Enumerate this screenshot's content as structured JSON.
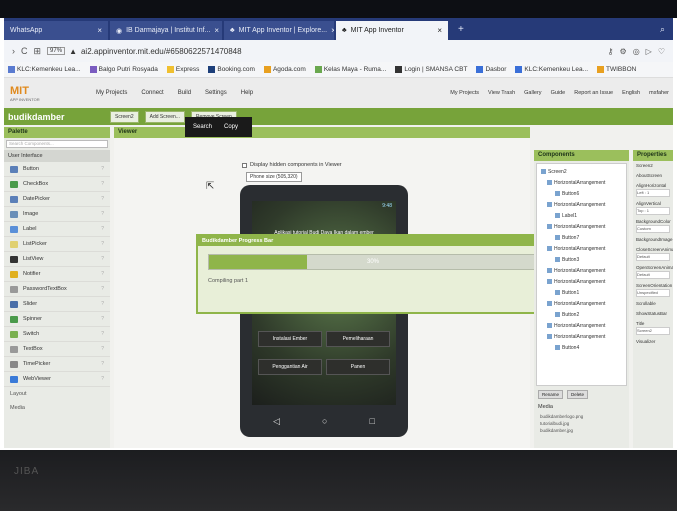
{
  "browser": {
    "tabs": [
      {
        "label": "WhatsApp",
        "active": false
      },
      {
        "label": "IB Darmajaya | Institut Inf...",
        "active": false
      },
      {
        "label": "MIT App Inventor | Explore...",
        "active": false
      },
      {
        "label": "MIT App Inventor",
        "active": true
      }
    ],
    "url": "ai2.appinventor.mit.edu/#6580622571470848",
    "url_badge": "97%",
    "bookmarks": [
      "KLC:Kemenkeu Lea...",
      "Balgo Putri Rosyada",
      "Express",
      "Booking.com",
      "Agoda.com",
      "Kelas Maya - Ruma...",
      "Login | SMANSA CBT",
      "Dasbor",
      "KLC:Kemenkeu Lea...",
      "TWIBBON"
    ]
  },
  "app": {
    "logo": "MIT",
    "logo_sub": "APP INVENTOR",
    "menu": [
      "My Projects",
      "Connect",
      "Build",
      "Settings",
      "Help"
    ],
    "header_links": [
      "My Projects",
      "View Trash",
      "Gallery",
      "Guide",
      "Report an Issue",
      "English",
      "msfaher"
    ],
    "dropdown": [
      "Search",
      "Copy"
    ],
    "project_name": "budikdamber",
    "screen_select": "Screen2",
    "add_screen": "Add Screen...",
    "remove_screen": "Remove Screen"
  },
  "palette": {
    "title": "Palette",
    "search_placeholder": "Search Components...",
    "category": "User Interface",
    "items": [
      "Button",
      "CheckBox",
      "DatePicker",
      "Image",
      "Label",
      "ListPicker",
      "ListView",
      "Notifier",
      "PasswordTextBox",
      "Slider",
      "Spinner",
      "Switch",
      "TextBox",
      "TimePicker",
      "WebViewer"
    ],
    "bottom": [
      "Layout",
      "Media"
    ]
  },
  "viewer": {
    "title": "Viewer",
    "hidden_check": "Display hidden components in Viewer",
    "phone_size": "Phone size (505,320)",
    "status_bar": "9:48",
    "phone_title": "Aplikasi tutorial Budi Daya Ikan dalam ember",
    "buttons": [
      "Instalasi Ember",
      "Pemeliharaan",
      "Penggantian Air",
      "Panen"
    ]
  },
  "dialog": {
    "title": "Budikdamber Progress Bar",
    "progress_value": 0.3,
    "progress_label": "30%",
    "status": "Compiling part 1"
  },
  "components": {
    "title": "Components",
    "tree": [
      "Screen2",
      "HorizontalArrangement",
      "Button6",
      "HorizontalArrangement",
      "Label1",
      "HorizontalArrangement",
      "Button7",
      "HorizontalArrangement",
      "Button3",
      "HorizontalArrangement",
      "HorizontalArrangement",
      "Button1",
      "HorizontalArrangement",
      "Button2",
      "HorizontalArrangement",
      "HorizontalArrangement",
      "Button4"
    ],
    "rename": "Rename",
    "delete": "Delete",
    "media_title": "Media",
    "media": [
      "budikdamberlogo.png",
      "tutorialbudi.jpg",
      "budikdamber.jpg"
    ]
  },
  "properties": {
    "title": "Properties",
    "items": [
      {
        "name": "Screen2",
        "value": ""
      },
      {
        "name": "AboutScreen",
        "value": ""
      },
      {
        "name": "AlignHorizontal",
        "value": "Left : 1"
      },
      {
        "name": "AlignVertical",
        "value": "Top : 1"
      },
      {
        "name": "BackgroundColor",
        "value": "Custom"
      },
      {
        "name": "BackgroundImage",
        "value": ""
      },
      {
        "name": "CloseScreenAnimation",
        "value": "Default"
      },
      {
        "name": "OpenScreenAnimation",
        "value": "Default"
      },
      {
        "name": "ScreenOrientation",
        "value": "Unspecified"
      },
      {
        "name": "Scrollable",
        "value": ""
      },
      {
        "name": "ShowStatusBar",
        "value": ""
      },
      {
        "name": "Title",
        "value": "Screen2"
      },
      {
        "name": "Visualizer",
        "value": ""
      }
    ]
  },
  "bezel_label": "JIBA"
}
